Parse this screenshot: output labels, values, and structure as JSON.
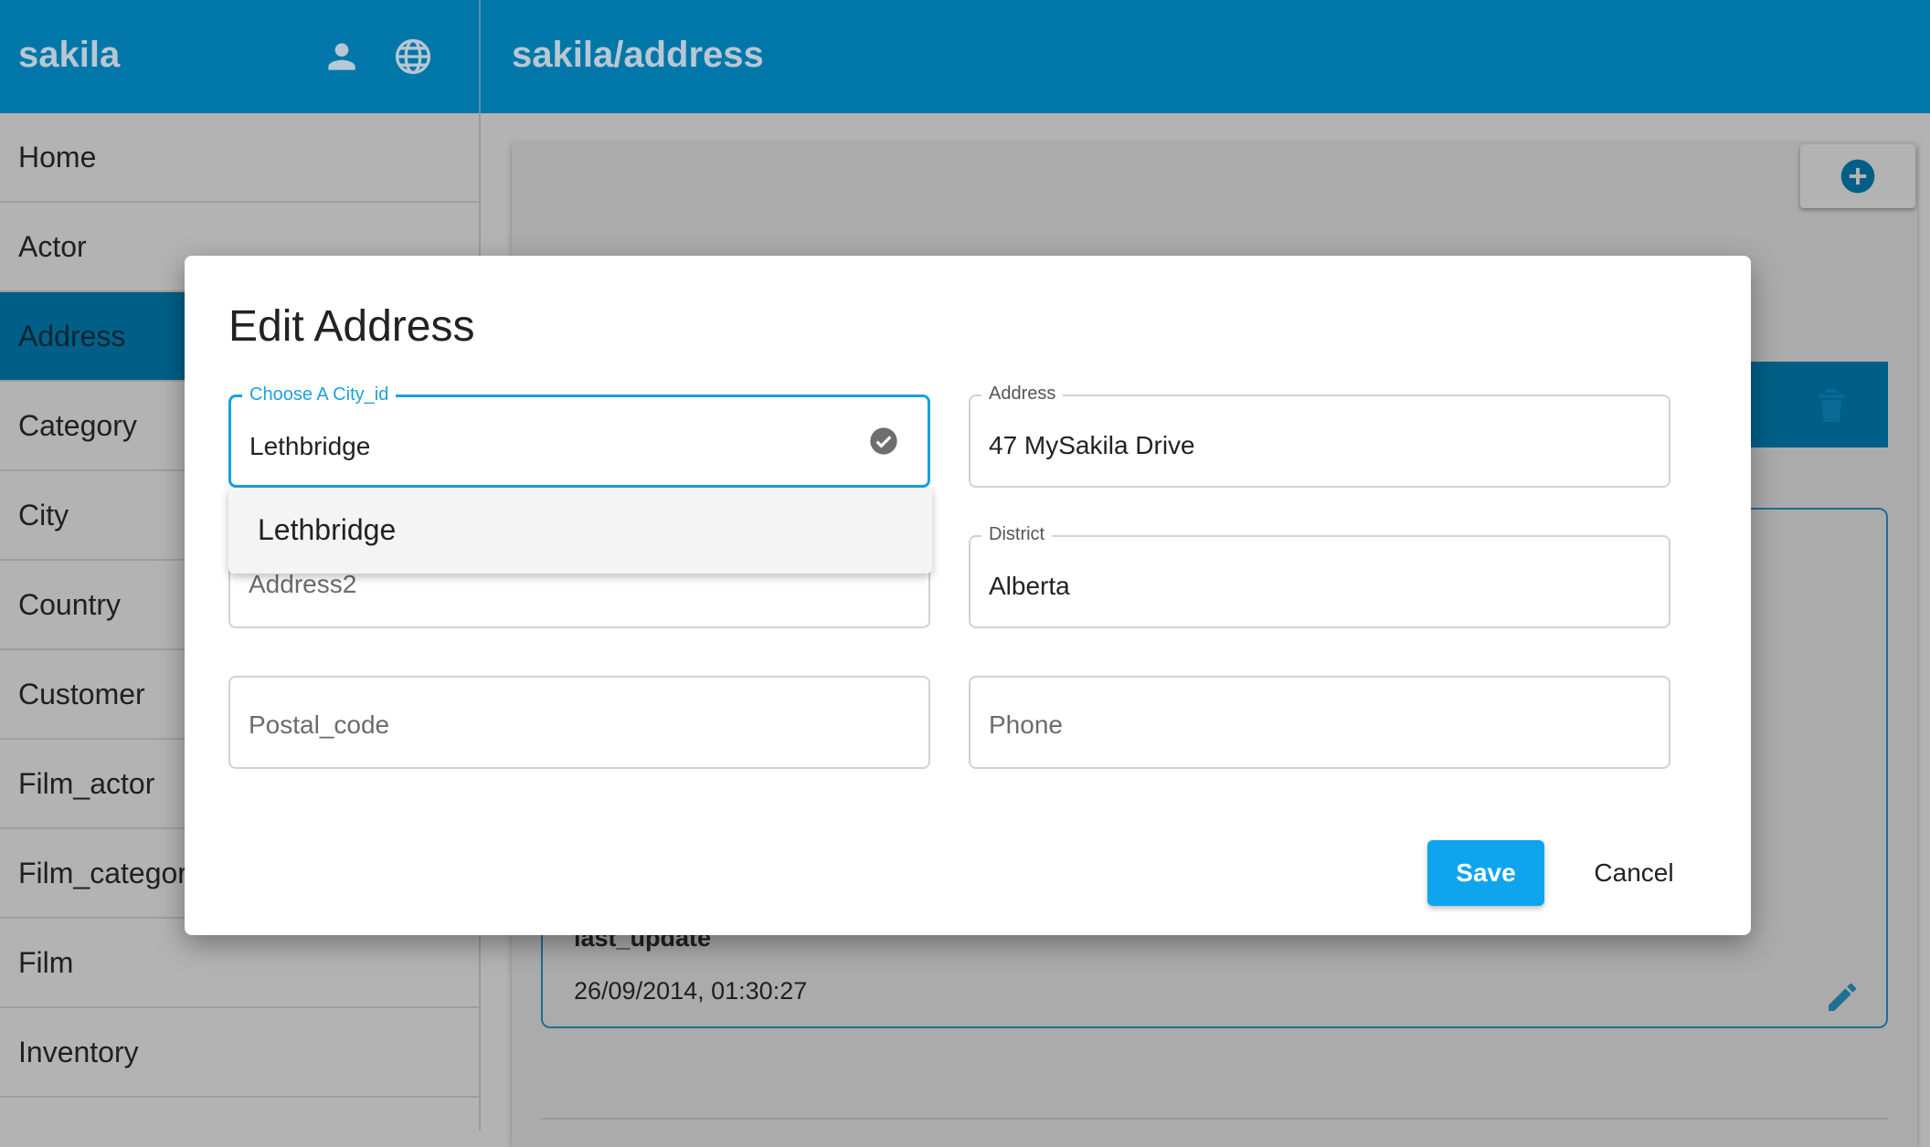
{
  "app": {
    "title": "sakila"
  },
  "header": {
    "title": "sakila/address"
  },
  "icons": {
    "user": "person-icon",
    "globe": "globe-icon",
    "add": "plus-circle-icon",
    "delete": "trash-icon",
    "edit": "pencil-icon",
    "check": "check-circle-icon"
  },
  "colors": {
    "primary": "#0077a8",
    "accent": "#0ea5ee",
    "focus": "#1aa1dc"
  },
  "sidebar": {
    "items": [
      {
        "label": "Home"
      },
      {
        "label": "Actor"
      },
      {
        "label": "Address"
      },
      {
        "label": "Category"
      },
      {
        "label": "City"
      },
      {
        "label": "Country"
      },
      {
        "label": "Customer"
      },
      {
        "label": "Film_actor"
      },
      {
        "label": "Film_category"
      },
      {
        "label": "Film"
      },
      {
        "label": "Inventory"
      }
    ]
  },
  "record": {
    "field_label": "last_update",
    "field_value": "26/09/2014, 01:30:27"
  },
  "dialog": {
    "title": "Edit Address",
    "city_field": {
      "label": "Choose A City_id",
      "value": "Lethbridge"
    },
    "dropdown_option": "Lethbridge",
    "address_field": {
      "label": "Address",
      "value": "47 MySakila Drive"
    },
    "address2_field": {
      "placeholder": "Address2"
    },
    "district_field": {
      "label": "District",
      "value": "Alberta"
    },
    "postal_field": {
      "placeholder": "Postal_code"
    },
    "phone_field": {
      "placeholder": "Phone"
    },
    "save_label": "Save",
    "cancel_label": "Cancel"
  }
}
